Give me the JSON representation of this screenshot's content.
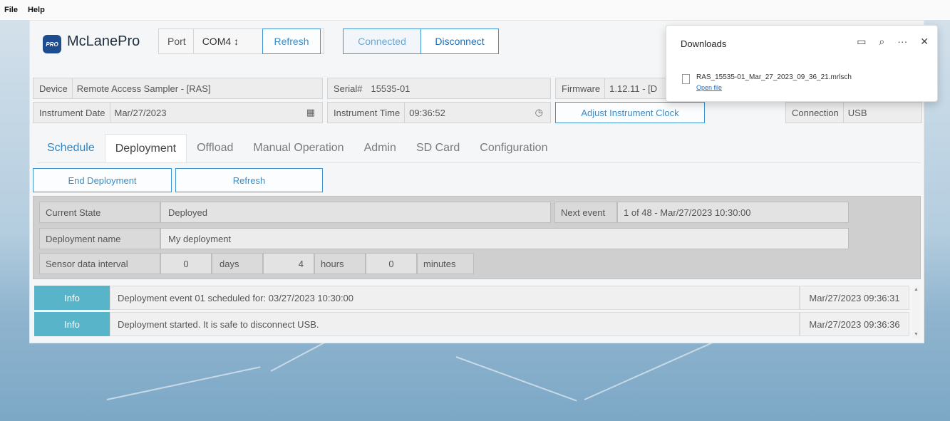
{
  "menubar": {
    "file": "File",
    "help": "Help"
  },
  "header": {
    "logo_badge": "PRO",
    "logo_text": "McLanePro",
    "port_label": "Port",
    "port_value": "COM4 ↕",
    "refresh_label": "Refresh",
    "connected_label": "Connected",
    "disconnect_label": "Disconnect"
  },
  "device": {
    "device_label": "Device",
    "device_value": "Remote Access Sampler - [RAS]",
    "serial_label": "Serial#",
    "serial_value": "15535-01",
    "firmware_label": "Firmware",
    "firmware_value": "1.12.11 - [D",
    "date_label": "Instrument Date",
    "date_value": "Mar/27/2023",
    "time_label": "Instrument Time",
    "time_value": "09:36:52",
    "adjust_label": "Adjust Instrument Clock",
    "connection_label": "Connection",
    "connection_value": "USB"
  },
  "tabs": [
    "Schedule",
    "Deployment",
    "Offload",
    "Manual Operation",
    "Admin",
    "SD Card",
    "Configuration"
  ],
  "actions": {
    "end_label": "End Deployment",
    "refresh_label": "Refresh"
  },
  "panel": {
    "state_label": "Current State",
    "state_value": "Deployed",
    "next_label": "Next event",
    "next_value": "1 of 48 - Mar/27/2023 10:30:00",
    "name_label": "Deployment name",
    "name_value": "My deployment",
    "interval_label": "Sensor data interval",
    "days_value": "0",
    "days_label": "days",
    "hours_value": "4",
    "hours_label": "hours",
    "minutes_value": "0",
    "minutes_label": "minutes"
  },
  "log": [
    {
      "level": "Info",
      "message": "Deployment event 01 scheduled for: 03/27/2023 10:30:00",
      "time": "Mar/27/2023 09:36:31"
    },
    {
      "level": "Info",
      "message": "Deployment started. It is safe to disconnect USB.",
      "time": "Mar/27/2023 09:36:36"
    }
  ],
  "downloads": {
    "title": "Downloads",
    "file_name": "RAS_15535-01_Mar_27_2023_09_36_21.mrlsch",
    "open_label": "Open file"
  },
  "colors": {
    "accent": "#3f95d1",
    "info_badge": "#58b4c9",
    "logo": "#1d4c8f"
  }
}
